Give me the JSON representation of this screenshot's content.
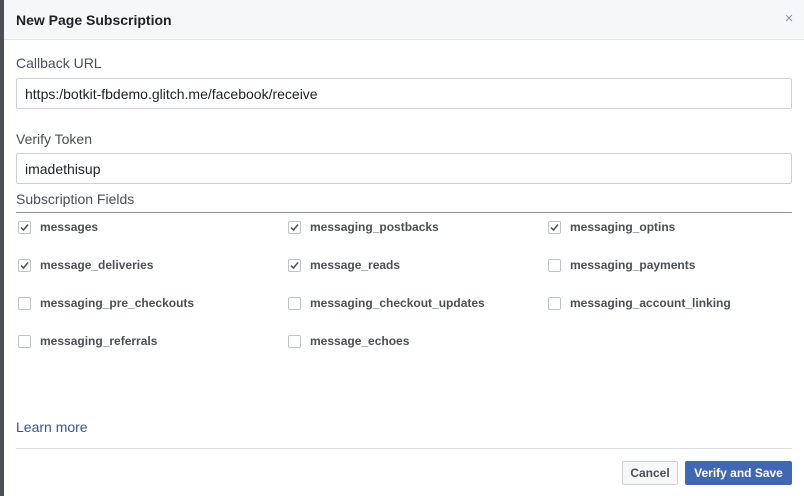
{
  "dialog": {
    "title": "New Page Subscription",
    "close_label": "×"
  },
  "form": {
    "callback_url_label": "Callback URL",
    "callback_url_value": "https:/botkit-fbdemo.glitch.me/facebook/receive",
    "verify_token_label": "Verify Token",
    "verify_token_value": "imadethisup"
  },
  "subscription_fields": {
    "heading": "Subscription Fields",
    "items": [
      {
        "label": "messages",
        "checked": true
      },
      {
        "label": "messaging_postbacks",
        "checked": true
      },
      {
        "label": "messaging_optins",
        "checked": true
      },
      {
        "label": "message_deliveries",
        "checked": true
      },
      {
        "label": "message_reads",
        "checked": true
      },
      {
        "label": "messaging_payments",
        "checked": false
      },
      {
        "label": "messaging_pre_checkouts",
        "checked": false
      },
      {
        "label": "messaging_checkout_updates",
        "checked": false
      },
      {
        "label": "messaging_account_linking",
        "checked": false
      },
      {
        "label": "messaging_referrals",
        "checked": false
      },
      {
        "label": "message_echoes",
        "checked": false
      }
    ]
  },
  "footer": {
    "learn_more": "Learn more",
    "cancel_label": "Cancel",
    "submit_label": "Verify and Save"
  },
  "colors": {
    "primary": "#4267b2",
    "link": "#365899",
    "checkmark": "#4b4f56"
  }
}
